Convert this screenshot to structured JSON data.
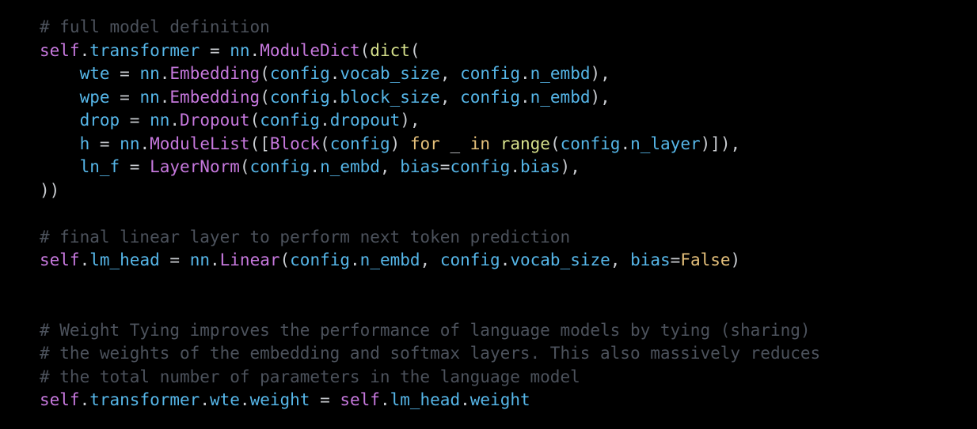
{
  "colors": {
    "background": "#000000",
    "comment": "#4c525c",
    "self": "#c678dd",
    "identifier": "#56b6e8",
    "operator": "#c9ccd1",
    "class": "#c678dd",
    "function": "#d6e08c",
    "keyword": "#e5c07b"
  },
  "code_lines": [
    [
      [
        "comment",
        "# full model definition"
      ]
    ],
    [
      [
        "self",
        "self"
      ],
      [
        "punct",
        "."
      ],
      [
        "ident",
        "transformer"
      ],
      [
        "op",
        " = "
      ],
      [
        "ident",
        "nn"
      ],
      [
        "punct",
        "."
      ],
      [
        "class",
        "ModuleDict"
      ],
      [
        "punct",
        "("
      ],
      [
        "func",
        "dict"
      ],
      [
        "punct",
        "("
      ]
    ],
    [
      [
        "op",
        "    "
      ],
      [
        "ident",
        "wte"
      ],
      [
        "op",
        " = "
      ],
      [
        "ident",
        "nn"
      ],
      [
        "punct",
        "."
      ],
      [
        "class",
        "Embedding"
      ],
      [
        "punct",
        "("
      ],
      [
        "ident",
        "config"
      ],
      [
        "punct",
        "."
      ],
      [
        "ident",
        "vocab_size"
      ],
      [
        "punct",
        ", "
      ],
      [
        "ident",
        "config"
      ],
      [
        "punct",
        "."
      ],
      [
        "ident",
        "n_embd"
      ],
      [
        "punct",
        "),"
      ]
    ],
    [
      [
        "op",
        "    "
      ],
      [
        "ident",
        "wpe"
      ],
      [
        "op",
        " = "
      ],
      [
        "ident",
        "nn"
      ],
      [
        "punct",
        "."
      ],
      [
        "class",
        "Embedding"
      ],
      [
        "punct",
        "("
      ],
      [
        "ident",
        "config"
      ],
      [
        "punct",
        "."
      ],
      [
        "ident",
        "block_size"
      ],
      [
        "punct",
        ", "
      ],
      [
        "ident",
        "config"
      ],
      [
        "punct",
        "."
      ],
      [
        "ident",
        "n_embd"
      ],
      [
        "punct",
        "),"
      ]
    ],
    [
      [
        "op",
        "    "
      ],
      [
        "ident",
        "drop"
      ],
      [
        "op",
        " = "
      ],
      [
        "ident",
        "nn"
      ],
      [
        "punct",
        "."
      ],
      [
        "class",
        "Dropout"
      ],
      [
        "punct",
        "("
      ],
      [
        "ident",
        "config"
      ],
      [
        "punct",
        "."
      ],
      [
        "ident",
        "dropout"
      ],
      [
        "punct",
        "),"
      ]
    ],
    [
      [
        "op",
        "    "
      ],
      [
        "ident",
        "h"
      ],
      [
        "op",
        " = "
      ],
      [
        "ident",
        "nn"
      ],
      [
        "punct",
        "."
      ],
      [
        "class",
        "ModuleList"
      ],
      [
        "punct",
        "(["
      ],
      [
        "class",
        "Block"
      ],
      [
        "punct",
        "("
      ],
      [
        "ident",
        "config"
      ],
      [
        "punct",
        ") "
      ],
      [
        "keyword",
        "for"
      ],
      [
        "op",
        " _ "
      ],
      [
        "keyword",
        "in"
      ],
      [
        "op",
        " "
      ],
      [
        "func",
        "range"
      ],
      [
        "punct",
        "("
      ],
      [
        "ident",
        "config"
      ],
      [
        "punct",
        "."
      ],
      [
        "ident",
        "n_layer"
      ],
      [
        "punct",
        ")]),"
      ]
    ],
    [
      [
        "op",
        "    "
      ],
      [
        "ident",
        "ln_f"
      ],
      [
        "op",
        " = "
      ],
      [
        "class",
        "LayerNorm"
      ],
      [
        "punct",
        "("
      ],
      [
        "ident",
        "config"
      ],
      [
        "punct",
        "."
      ],
      [
        "ident",
        "n_embd"
      ],
      [
        "punct",
        ", "
      ],
      [
        "ident",
        "bias"
      ],
      [
        "op",
        "="
      ],
      [
        "ident",
        "config"
      ],
      [
        "punct",
        "."
      ],
      [
        "ident",
        "bias"
      ],
      [
        "punct",
        "),"
      ]
    ],
    [
      [
        "punct",
        "))"
      ]
    ],
    [],
    [
      [
        "comment",
        "# final linear layer to perform next token prediction"
      ]
    ],
    [
      [
        "self",
        "self"
      ],
      [
        "punct",
        "."
      ],
      [
        "ident",
        "lm_head"
      ],
      [
        "op",
        " = "
      ],
      [
        "ident",
        "nn"
      ],
      [
        "punct",
        "."
      ],
      [
        "class",
        "Linear"
      ],
      [
        "punct",
        "("
      ],
      [
        "ident",
        "config"
      ],
      [
        "punct",
        "."
      ],
      [
        "ident",
        "n_embd"
      ],
      [
        "punct",
        ", "
      ],
      [
        "ident",
        "config"
      ],
      [
        "punct",
        "."
      ],
      [
        "ident",
        "vocab_size"
      ],
      [
        "punct",
        ", "
      ],
      [
        "ident",
        "bias"
      ],
      [
        "op",
        "="
      ],
      [
        "const",
        "False"
      ],
      [
        "punct",
        ")"
      ]
    ],
    [],
    [],
    [
      [
        "comment",
        "# Weight Tying improves the performance of language models by tying (sharing)"
      ]
    ],
    [
      [
        "comment",
        "# the weights of the embedding and softmax layers. This also massively reduces"
      ]
    ],
    [
      [
        "comment",
        "# the total number of parameters in the language model"
      ]
    ],
    [
      [
        "self",
        "self"
      ],
      [
        "punct",
        "."
      ],
      [
        "ident",
        "transformer"
      ],
      [
        "punct",
        "."
      ],
      [
        "ident",
        "wte"
      ],
      [
        "punct",
        "."
      ],
      [
        "ident",
        "weight"
      ],
      [
        "op",
        " = "
      ],
      [
        "self",
        "self"
      ],
      [
        "punct",
        "."
      ],
      [
        "ident",
        "lm_head"
      ],
      [
        "punct",
        "."
      ],
      [
        "ident",
        "weight"
      ]
    ]
  ]
}
